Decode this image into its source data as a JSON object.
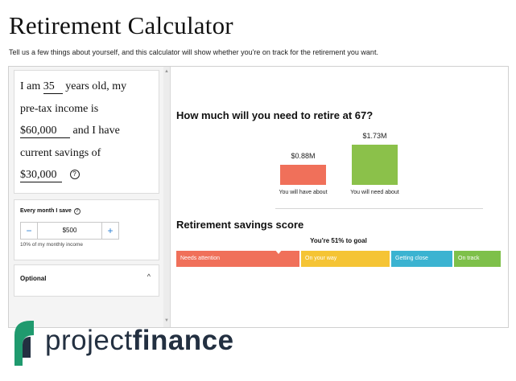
{
  "page": {
    "title": "Retirement Calculator",
    "subtitle": "Tell us a few things about yourself, and this calculator will show whether you're on track for the retirement you want."
  },
  "inputs": {
    "line1_pre": "I am",
    "age": "35",
    "line1_post": "years old, my",
    "line2": "pre-tax income is",
    "income": "$60,000",
    "line3_post": "and I have",
    "line4": "current savings of",
    "savings": "$30,000",
    "help_glyph": "?"
  },
  "monthly": {
    "label": "Every month I save",
    "help_glyph": "?",
    "minus": "−",
    "plus": "+",
    "value": "$500",
    "note": "10% of my monthly income"
  },
  "optional": {
    "label": "Optional",
    "chevron": "^"
  },
  "result": {
    "heading": "How much will you need to retire at 67?",
    "have_value": "$0.88M",
    "have_caption": "You will have about",
    "need_value": "$1.73M",
    "need_caption": "You will need about",
    "have_amount": 0.88,
    "need_amount": 1.73,
    "have_color": "#f0705a",
    "need_color": "#8bc14a"
  },
  "score": {
    "heading": "Retirement savings score",
    "goal_text": "You're 51% to goal",
    "percent": 51,
    "segments": [
      {
        "label": "Needs attention",
        "color": "#f0705a"
      },
      {
        "label": "On your way",
        "color": "#f5c435"
      },
      {
        "label": "Getting close",
        "color": "#3bb3d1"
      },
      {
        "label": "On track",
        "color": "#7ec04a"
      }
    ]
  },
  "logo": {
    "word_a": "project",
    "word_b": "finance",
    "mark_color": "#1f9a6e",
    "text_color": "#233041"
  }
}
